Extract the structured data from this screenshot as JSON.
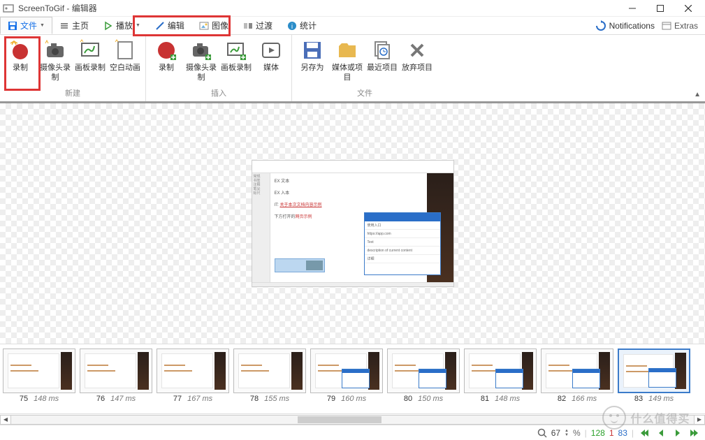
{
  "title": "ScreenToGif - 编辑器",
  "tabs": {
    "file": "文件",
    "home": "主页",
    "play": "播放",
    "edit": "编辑",
    "image": "图像",
    "transition": "过渡",
    "stats": "统计"
  },
  "topbar": {
    "notifications": "Notifications",
    "extras": "Extras"
  },
  "ribbon": {
    "new": {
      "label": "新建",
      "record": "录制",
      "webcam": "摄像头录制",
      "board": "画板录制",
      "blank": "空白动画"
    },
    "insert": {
      "label": "插入",
      "record": "录制",
      "webcam": "摄像头录制",
      "board": "画板录制",
      "media": "媒体"
    },
    "file": {
      "label": "文件",
      "saveas": "另存为",
      "mediaproj": "媒体或项目",
      "recent": "最近项目",
      "discard": "放弃项目"
    }
  },
  "frames": [
    {
      "num": "75",
      "ms": "148 ms",
      "popup": false
    },
    {
      "num": "76",
      "ms": "147 ms",
      "popup": false
    },
    {
      "num": "77",
      "ms": "167 ms",
      "popup": false
    },
    {
      "num": "78",
      "ms": "155 ms",
      "popup": false
    },
    {
      "num": "79",
      "ms": "160 ms",
      "popup": true
    },
    {
      "num": "80",
      "ms": "150 ms",
      "popup": true
    },
    {
      "num": "81",
      "ms": "148 ms",
      "popup": true
    },
    {
      "num": "82",
      "ms": "166 ms",
      "popup": true
    },
    {
      "num": "83",
      "ms": "149 ms",
      "popup": true,
      "selected": true
    }
  ],
  "status": {
    "zoom": "67",
    "frames_total": "128",
    "frames_sel": "1",
    "frames_cur": "83"
  },
  "watermark": "什么值得买"
}
